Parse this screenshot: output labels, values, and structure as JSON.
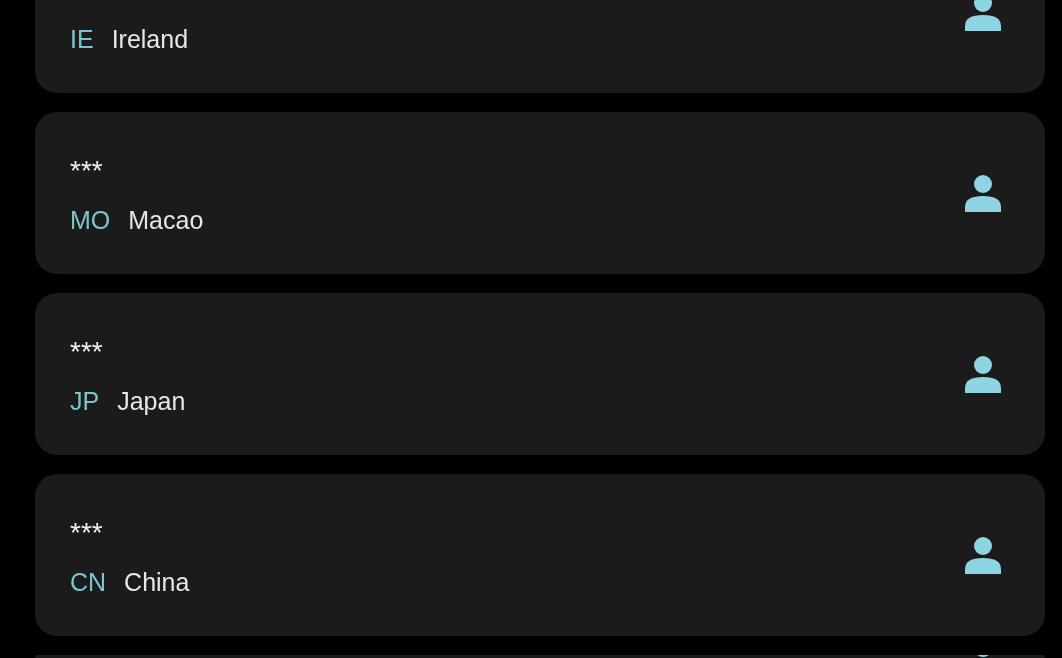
{
  "contacts": [
    {
      "kind": "contact",
      "code": "IE",
      "country": "Ireland"
    },
    {
      "kind": "contact",
      "masked": "***",
      "code": "MO",
      "country": "Macao"
    },
    {
      "kind": "contact",
      "masked": "***",
      "code": "JP",
      "country": "Japan"
    },
    {
      "kind": "contact",
      "masked": "***",
      "code": "CN",
      "country": "China"
    },
    {
      "kind": "contact"
    }
  ]
}
